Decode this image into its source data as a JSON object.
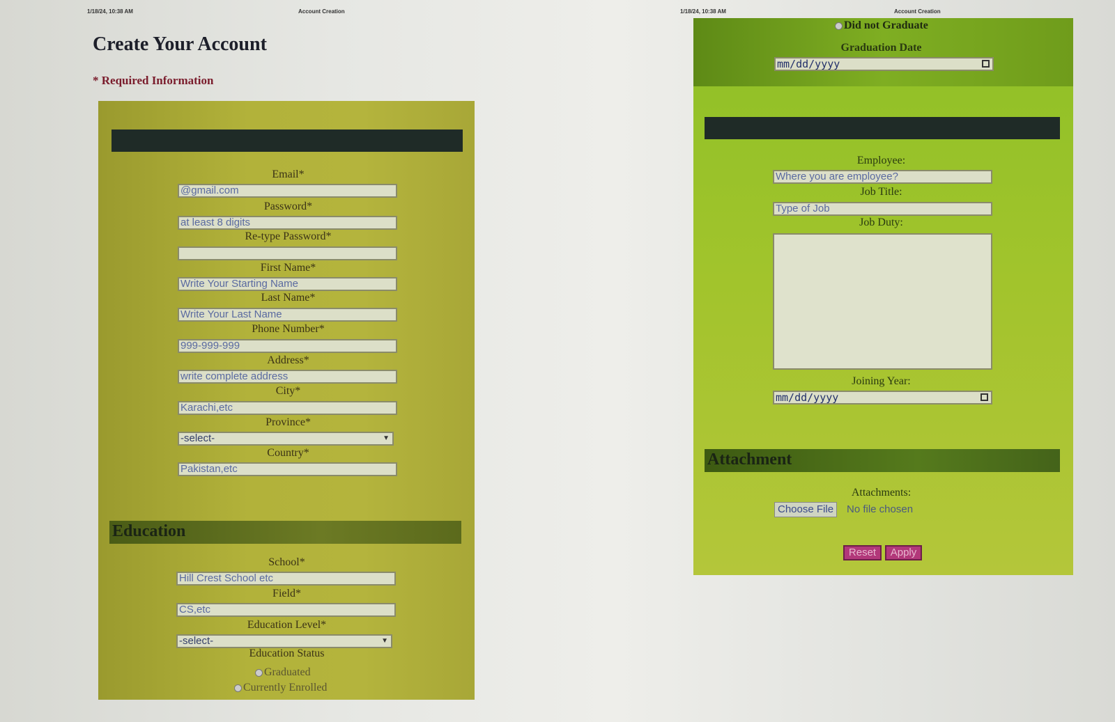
{
  "print_header": {
    "left_date": "1/18/24, 10:38 AM",
    "left_title": "Account Creation",
    "right_date": "1/18/24, 10:38 AM",
    "right_title": "Account Creation"
  },
  "page": {
    "title": "Create Your Account",
    "required_note": "* Required Information"
  },
  "account_form": {
    "email": {
      "label": "Email*",
      "placeholder": "@gmail.com"
    },
    "password": {
      "label": "Password*",
      "placeholder": "at least 8 digits"
    },
    "retype_password": {
      "label": "Re-type Password*",
      "placeholder": ""
    },
    "first_name": {
      "label": "First Name*",
      "placeholder": "Write Your Starting Name"
    },
    "last_name": {
      "label": "Last Name*",
      "placeholder": "Write Your Last Name"
    },
    "phone": {
      "label": "Phone Number*",
      "placeholder": "999-999-999"
    },
    "address": {
      "label": "Address*",
      "placeholder": "write complete address"
    },
    "city": {
      "label": "City*",
      "placeholder": "Karachi,etc"
    },
    "province": {
      "label": "Province*",
      "selected": "-select-"
    },
    "country": {
      "label": "Country*",
      "placeholder": "Pakistan,etc"
    }
  },
  "education": {
    "title": "Education",
    "school": {
      "label": "School*",
      "placeholder": "Hill Crest School etc"
    },
    "field": {
      "label": "Field*",
      "placeholder": "CS,etc"
    },
    "level": {
      "label": "Education Level*",
      "selected": "-select-"
    },
    "status_label": "Education Status",
    "status_options": [
      "Graduated",
      "Currently Enrolled",
      "Did not Graduate"
    ],
    "graduation_date": {
      "label": "Graduation Date",
      "value": "mm/dd/yyyy"
    }
  },
  "employment": {
    "employee": {
      "label": "Employee:",
      "placeholder": "Where you are employee?"
    },
    "job_title": {
      "label": "Job Title:",
      "placeholder": "Type of Job"
    },
    "job_duty": {
      "label": "Job Duty:"
    },
    "joining_year": {
      "label": "Joining Year:",
      "value": "mm/dd/yyyy"
    }
  },
  "attachment": {
    "title": "Attachment",
    "label": "Attachments:",
    "file_button": "Choose File",
    "file_status": "No file chosen"
  },
  "actions": {
    "reset": "Reset",
    "apply": "Apply"
  },
  "colors": {
    "left_panel": "#b2b23a",
    "right_panel": "#93c128",
    "dark_bar": "#1f2b27",
    "button": "#b2387a"
  }
}
